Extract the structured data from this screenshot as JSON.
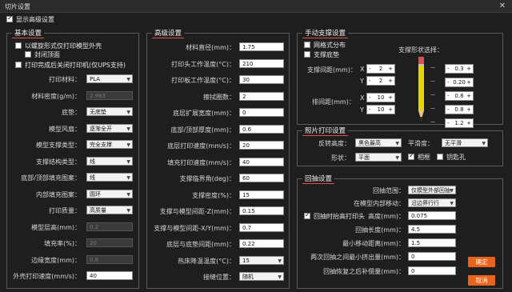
{
  "window": {
    "title": "切片设置",
    "close": "✕"
  },
  "show_advanced": {
    "label": "显示高级设置",
    "checked": true
  },
  "basic": {
    "title": "基本设置",
    "cb1": "以螺旋形式仅打印模型外壳",
    "cb2": "封闭顶面",
    "cb3": "打印完成后关闭打印机(仅UPS支持)",
    "rows": [
      {
        "label": "打印材料：",
        "value": "PLA",
        "kind": "select"
      },
      {
        "label": "材料密度(g/m)：",
        "value": "2.983",
        "kind": "disabled"
      },
      {
        "label": "底垫：",
        "value": "无底垫",
        "kind": "select"
      },
      {
        "label": "模型风扇：",
        "value": "逐渐全开",
        "kind": "select"
      },
      {
        "label": "模型支撑类型：",
        "value": "完全支撑",
        "kind": "select"
      },
      {
        "label": "支撑结构类型：",
        "value": "线",
        "kind": "select"
      },
      {
        "label": "底部/顶部填充图案：",
        "value": "线",
        "kind": "select"
      },
      {
        "label": "内部填充图案：",
        "value": "圆环",
        "kind": "select"
      },
      {
        "label": "打印质量：",
        "value": "高质量",
        "kind": "select"
      },
      {
        "label": "模型层高(mm)：",
        "value": "0.2",
        "kind": "disabled"
      },
      {
        "label": "填充率(%)：",
        "value": "20",
        "kind": "disabled"
      },
      {
        "label": "边缘宽度(mm)：",
        "value": "0.8",
        "kind": "disabled"
      },
      {
        "label": "外壳打印速度(mm/s)：",
        "value": "40",
        "kind": "input"
      }
    ]
  },
  "advanced": {
    "title": "高级设置",
    "rows": [
      {
        "label": "材料直径(mm)：",
        "value": "1.75",
        "kind": "input"
      },
      {
        "label": "打印头工作温度(°C)：",
        "value": "210",
        "kind": "input"
      },
      {
        "label": "打印板工作温度(°C)：",
        "value": "30",
        "kind": "input"
      },
      {
        "label": "擦拭圈数：",
        "value": "2",
        "kind": "input"
      },
      {
        "label": "底层扩展宽度(mm)：",
        "value": "0",
        "kind": "input"
      },
      {
        "label": "底部/顶部厚度(mm)：",
        "value": "0.6",
        "kind": "input"
      },
      {
        "label": "底层打印速度(mm/s)：",
        "value": "20",
        "kind": "input"
      },
      {
        "label": "填充打印速度(mm/s)：",
        "value": "40",
        "kind": "input"
      },
      {
        "label": "支撑临界角(deg)：",
        "value": "60",
        "kind": "input"
      },
      {
        "label": "支撑密度(%)：",
        "value": "15",
        "kind": "input"
      },
      {
        "label": "支撑与模型间距-Z(mm)：",
        "value": "0.15",
        "kind": "input"
      },
      {
        "label": "支撑与模型间距-X/Y(mm)：",
        "value": "0.7",
        "kind": "input"
      },
      {
        "label": "底层与底垫间距(mm)：",
        "value": "0.22",
        "kind": "input"
      },
      {
        "label": "热床降温温度(°C)：",
        "value": "15",
        "kind": "select"
      },
      {
        "label": "接缝位置：",
        "value": "随机",
        "kind": "select"
      }
    ]
  },
  "manual_support": {
    "title": "手动支撑设置",
    "cb1": "网格式分布",
    "cb2": "支撑底垫",
    "shape_label": "支撑形状选择：",
    "support_spacing": "支撑间距(mm)：",
    "row_spacing": "排间距(mm)：",
    "X": "X",
    "Y": "Y",
    "spins": {
      "sx": "2",
      "sy": "2",
      "rx": "10",
      "ry": "10"
    },
    "shape_values": [
      "0.3",
      "0.20",
      "0.8",
      "0.8",
      "1.2"
    ]
  },
  "photo": {
    "title": "照片打印设置",
    "reverse_label": "反转高度：",
    "reverse_value": "黑色最高",
    "smooth_label": "平滑度：",
    "smooth_value": "无平滑",
    "shape_label": "形状：",
    "shape_value": "平面",
    "frame_label": "相框",
    "keyhole_label": "钥匙孔"
  },
  "retract": {
    "title": "回抽设置",
    "range_label": "回抽范围：",
    "range_value": "仅模型外部回抽",
    "move_label": "在模型内部移动：",
    "move_value": "沿边界行行",
    "lift_cb": "回抽时抬高打印头",
    "height_label": "高度(mm)：",
    "height_value": "0.075",
    "len_label": "回抽长度(mm)：",
    "len_value": "4.5",
    "min_move_label": "最小移动距离(mm)：",
    "min_move_value": "1.5",
    "min_extr_label": "两次回抽之间最小挤出量(mm)：",
    "min_extr_value": "0",
    "recover_label": "回抽恢复之后补偿量(mm)：",
    "recover_value": "0"
  },
  "buttons": {
    "ok": "确定",
    "cancel": "取消"
  }
}
